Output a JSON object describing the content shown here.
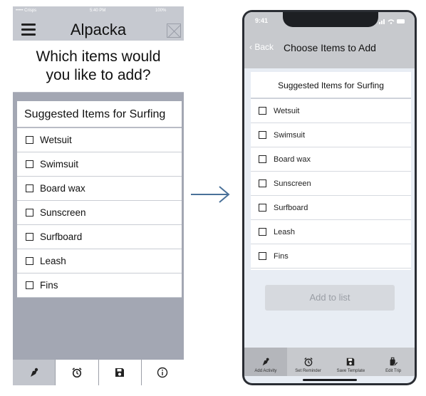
{
  "left_phone": {
    "status": {
      "carrier": "••••• Crisps",
      "time": "5:40 PM",
      "battery": "100%"
    },
    "nav": {
      "title": "Alpacka"
    },
    "question_lines": [
      "Which items would",
      "you like to add?"
    ],
    "card": {
      "title": "Suggested Items for Surfing",
      "items": [
        "Wetsuit",
        "Swimsuit",
        "Board wax",
        "Sunscreen",
        "Surfboard",
        "Leash",
        "Fins"
      ]
    },
    "tabs": [
      {
        "icon": "add-activity-icon"
      },
      {
        "icon": "alarm-clock-icon"
      },
      {
        "icon": "save-icon"
      },
      {
        "icon": "info-icon"
      }
    ]
  },
  "right_phone": {
    "status": {
      "time": "9:41"
    },
    "nav": {
      "back_label": "Back",
      "title": "Choose Items to Add"
    },
    "card": {
      "title": "Suggested Items for Surfing",
      "items": [
        "Wetsuit",
        "Swimsuit",
        "Board wax",
        "Sunscreen",
        "Surfboard",
        "Leash",
        "Fins"
      ]
    },
    "add_button_label": "Add to list",
    "tabs": [
      {
        "label": "Add Activity",
        "icon": "add-activity-icon"
      },
      {
        "label": "Set Reminder",
        "icon": "alarm-clock-icon"
      },
      {
        "label": "Save Template",
        "icon": "save-icon"
      },
      {
        "label": "Edit Trip",
        "icon": "edit-trip-icon"
      }
    ]
  },
  "colors": {
    "arrow": "#4a7199",
    "left_background": "#a3a7b3",
    "right_background": "#e8edf4",
    "bar_gray": "#c7c9cd"
  }
}
